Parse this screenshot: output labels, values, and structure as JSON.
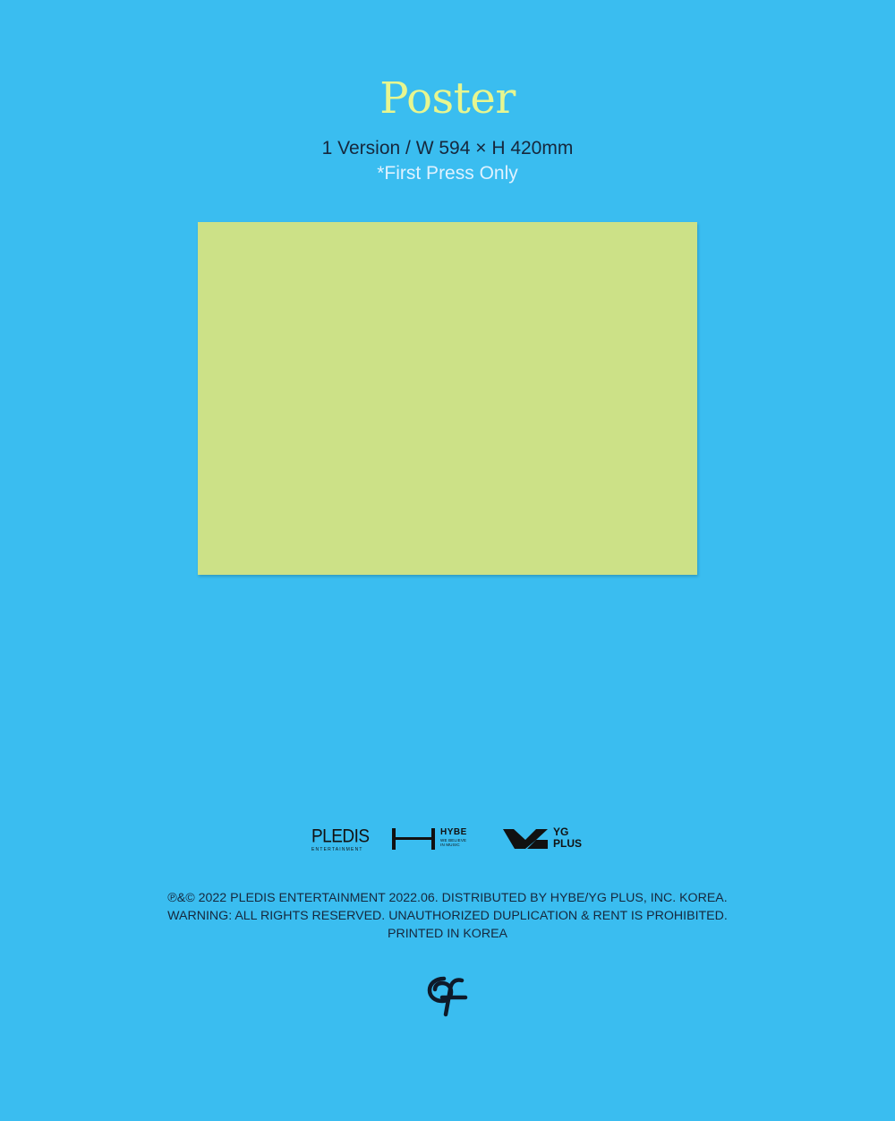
{
  "header": {
    "title": "Poster",
    "spec": "1 Version / W 594 × H 420mm",
    "note": "*First Press Only"
  },
  "poster": {
    "color": "#cce187"
  },
  "logos": {
    "pledis": {
      "name": "PLEDIS",
      "subtitle": "ENTERTAINMENT"
    },
    "hybe": {
      "name": "HYBE",
      "tagline": "WE BELIEVE IN MUSIC"
    },
    "yg": {
      "line1": "YG",
      "line2": "PLUS"
    }
  },
  "legal": {
    "line1": "℗&© 2022 PLEDIS ENTERTAINMENT 2022.06. DISTRIBUTED BY HYBE/YG PLUS, INC. KOREA.",
    "line2": "WARNING: ALL RIGHTS RESERVED. UNAUTHORIZED DUPLICATION & RENT IS PROHIBITED.",
    "line3": "PRINTED IN KOREA"
  },
  "colors": {
    "background": "#3abdf0",
    "title": "#e7f68f",
    "text_dark": "#16283d",
    "text_light": "#dff2ff"
  },
  "icons": {
    "footer_emblem": "fromis-monogram-icon"
  }
}
